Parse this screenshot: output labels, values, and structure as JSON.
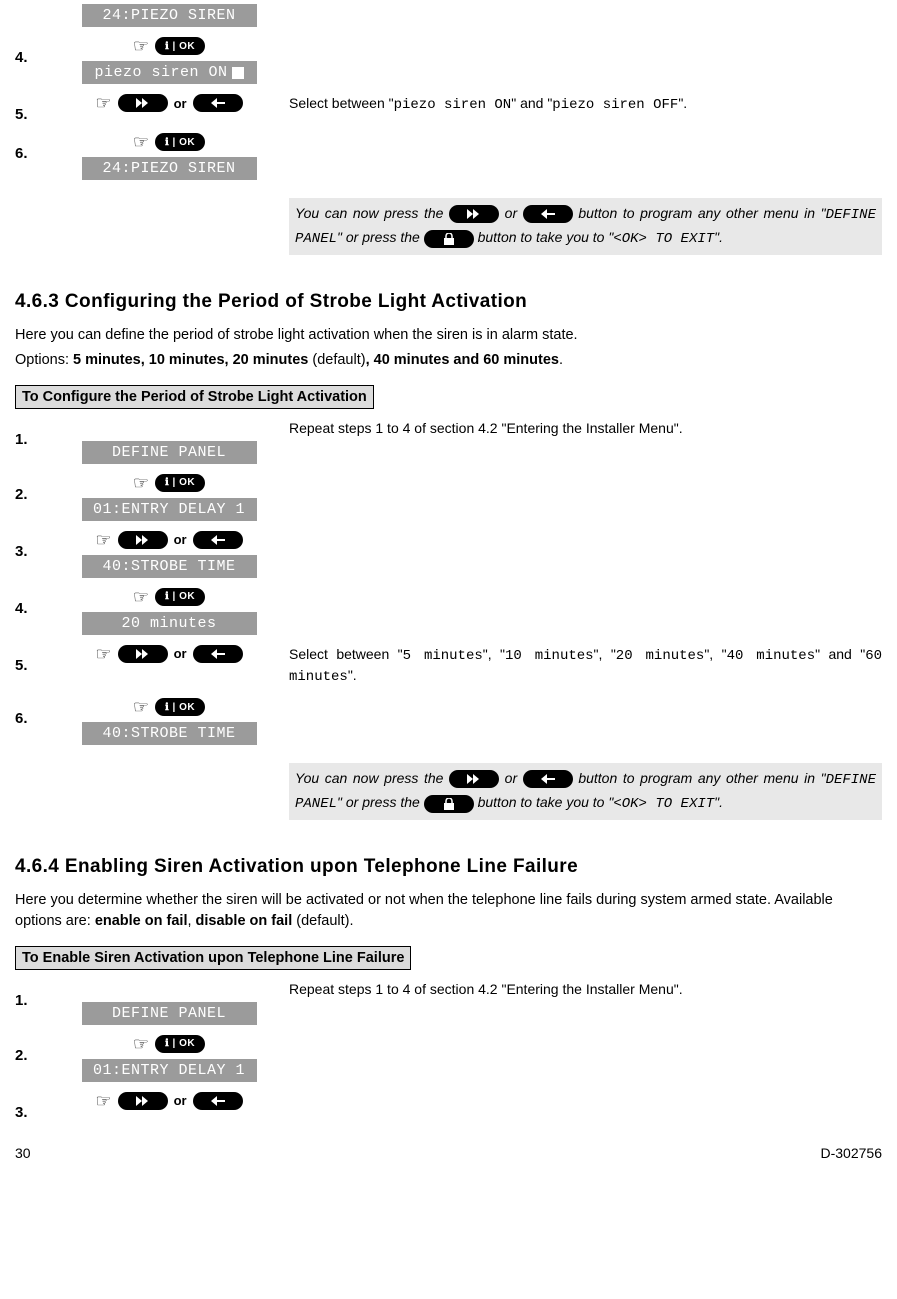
{
  "top": {
    "lcd0": "24:PIEZO SIREN",
    "step4": "4.",
    "lcd4a": "piezo siren ON",
    "step5": "5.",
    "or": "or",
    "desc5_a": "Select between \"",
    "desc5_b": "piezo siren ON",
    "desc5_c": "\" and \"",
    "desc5_d": "piezo siren OFF",
    "desc5_e": "\".",
    "step6": "6.",
    "lcd6": "24:PIEZO SIREN"
  },
  "note": {
    "a": "You can now press the ",
    "b": " or ",
    "c": " button to program any other menu in \"",
    "d": "DEFINE PANEL",
    "e": "\" or press the ",
    "f": " button to take you to \"",
    "g": "<OK> TO EXIT",
    "h": "\"."
  },
  "sec463": {
    "title": "4.6.3 Configuring the Period of Strobe Light Activation",
    "intro1": "Here you can define the period of strobe light activation when the siren is in alarm state.",
    "intro2a": "Options: ",
    "intro2b": "5 minutes, 10 minutes, 20 minutes",
    "intro2c": " (default)",
    "intro2d": ", 40 minutes and 60 minutes",
    "intro2e": ".",
    "header": "To Configure the Period of Strobe Light Activation",
    "step1": "1.",
    "desc1": "Repeat steps 1 to 4 of section 4.2 \"Entering the Installer Menu\".",
    "lcd1": "DEFINE PANEL",
    "step2": "2.",
    "lcd2": "01:ENTRY DELAY 1",
    "step3": "3.",
    "lcd3": "40:STROBE TIME",
    "step4": "4.",
    "lcd4": "20 minutes",
    "step5": "5.",
    "desc5_a": "Select between \"",
    "desc5_b": "5 minutes",
    "desc5_c": "\", \"",
    "desc5_d": "10 minutes",
    "desc5_e": "\", \"",
    "desc5_f": "20 minutes",
    "desc5_g": "\", \"",
    "desc5_h": "40 minutes",
    "desc5_i": "\" and \"",
    "desc5_j": "60 minutes",
    "desc5_k": "\".",
    "step6": "6.",
    "lcd6": "40:STROBE TIME"
  },
  "sec464": {
    "title": "4.6.4 Enabling Siren Activation upon Telephone Line Failure",
    "intro_a": "Here you determine whether the siren will be activated or not when the telephone line fails during system armed state. Available options are: ",
    "intro_b": "enable on fail",
    "intro_c": ", ",
    "intro_d": "disable on fail",
    "intro_e": " (default).",
    "header": "To Enable Siren Activation upon Telephone Line Failure",
    "step1": "1.",
    "desc1": "Repeat steps 1 to 4 of section 4.2 \"Entering the Installer Menu\".",
    "lcd1": "DEFINE PANEL",
    "step2": "2.",
    "lcd2": "01:ENTRY DELAY 1",
    "step3": "3."
  },
  "pill": {
    "info_ok": "ℹ | OK"
  },
  "footer": {
    "page": "30",
    "doc": "D-302756"
  }
}
